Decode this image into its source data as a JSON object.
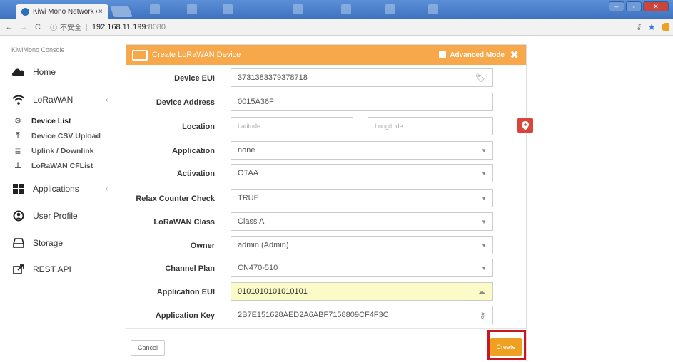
{
  "browser": {
    "tab_title": "Kiwi Mono Network Ad",
    "tab_close": "×",
    "back": "←",
    "forward": "→",
    "reload": "C",
    "security_icon": "ⓘ",
    "security_text": "不安全",
    "url_host": "192.168.11.199",
    "url_port": ":8080"
  },
  "sidebar": {
    "brand": "KiwiMono Console",
    "items": [
      {
        "label": "Home",
        "icon": "cloud-icon"
      },
      {
        "label": "LoRaWAN",
        "icon": "wifi-icon",
        "chevron": "‹"
      },
      {
        "label": "Applications",
        "icon": "windows-icon",
        "chevron": "‹"
      },
      {
        "label": "User Profile",
        "icon": "user-icon"
      },
      {
        "label": "Storage",
        "icon": "storage-icon"
      },
      {
        "label": "REST API",
        "icon": "share-icon"
      }
    ],
    "sub_items": [
      {
        "label": "Device List",
        "icon": "gears-icon"
      },
      {
        "label": "Device CSV Upload",
        "icon": "upload-icon"
      },
      {
        "label": "Uplink / Downlink",
        "icon": "database-icon"
      },
      {
        "label": "LoRaWAN CFList",
        "icon": "sitemap-icon"
      }
    ]
  },
  "modal": {
    "title": "Create LoRaWAN Device",
    "advanced_mode": "Advanced Mode",
    "close": "✖",
    "fields": {
      "device_eui": {
        "label": "Device EUI",
        "value": "3731383379378718"
      },
      "device_address": {
        "label": "Device Address",
        "value": "0015A36F"
      },
      "location": {
        "label": "Location",
        "lat_placeholder": "Latitude",
        "lng_placeholder": "Longitude"
      },
      "application": {
        "label": "Application",
        "value": "none"
      },
      "activation": {
        "label": "Activation",
        "value": "OTAA"
      },
      "relax_counter": {
        "label": "Relax Counter Check",
        "value": "TRUE"
      },
      "lorawan_class": {
        "label": "LoRaWAN Class",
        "value": "Class A"
      },
      "owner": {
        "label": "Owner",
        "value": "admin (Admin)"
      },
      "channel_plan": {
        "label": "Channel Plan",
        "value": "CN470-510"
      },
      "application_eui": {
        "label": "Application EUI",
        "value": "0101010101010101"
      },
      "application_key": {
        "label": "Application Key",
        "value": "2B7E151628AED2A6ABF7158809CF4F3C"
      }
    },
    "cancel_label": "Cancel",
    "create_label": "Create"
  },
  "colors": {
    "header": "#f7a84a",
    "create": "#f0a020",
    "highlight": "#c9171e",
    "pin": "#d9443b",
    "eui_bg": "#fbfbc8"
  }
}
